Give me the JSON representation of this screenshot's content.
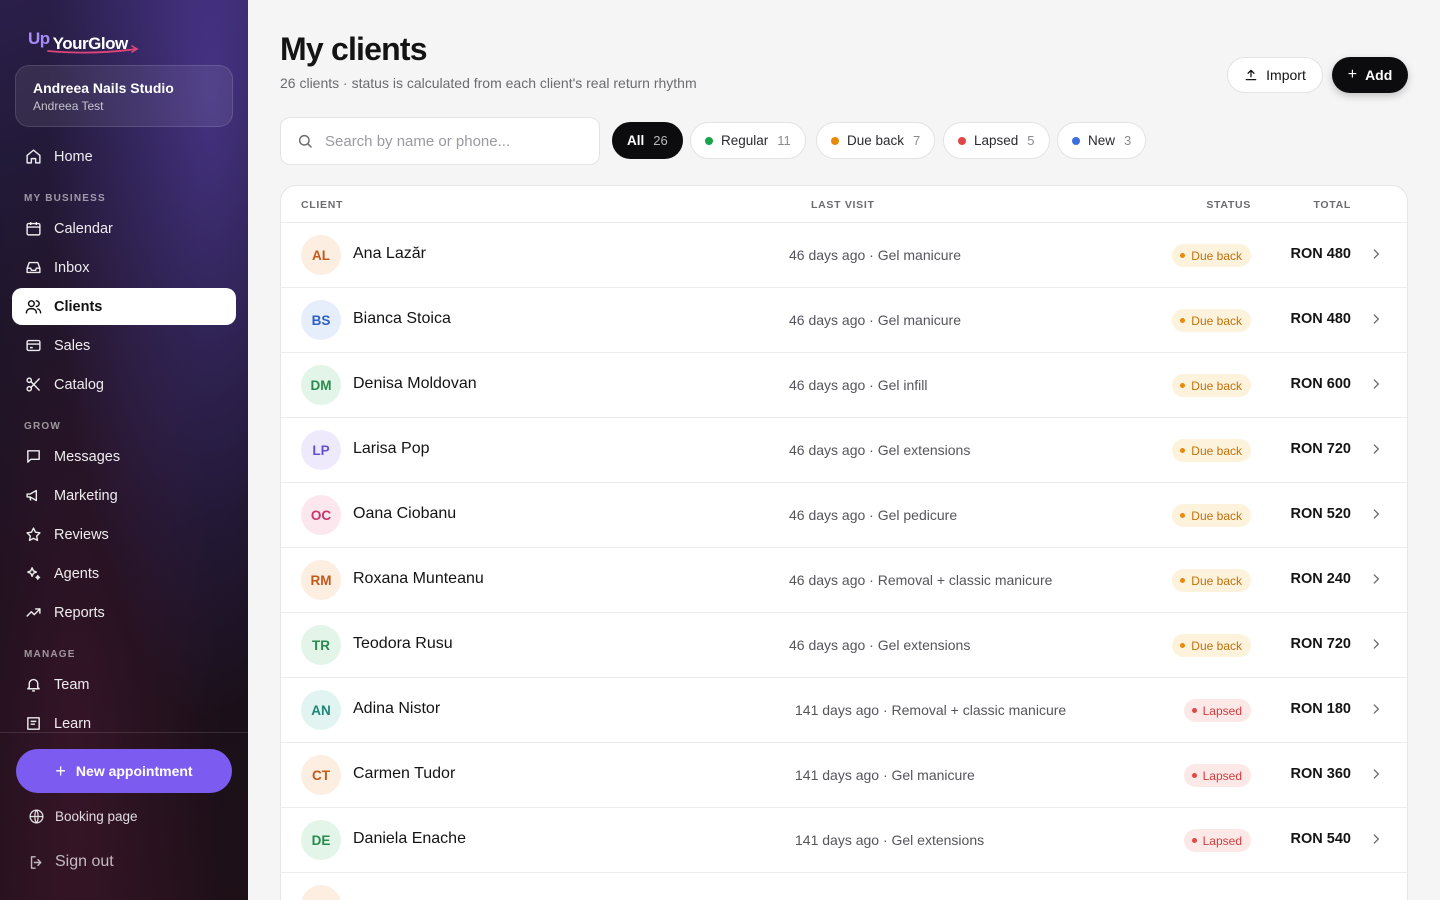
{
  "brand": {
    "up": "Up",
    "name": "YourGlow"
  },
  "studio": {
    "name": "Andreea Nails Studio",
    "owner": "Andreea Test"
  },
  "nav": {
    "home": "Home",
    "section_business": "MY BUSINESS",
    "calendar": "Calendar",
    "inbox": "Inbox",
    "clients": "Clients",
    "sales": "Sales",
    "catalog": "Catalog",
    "section_grow": "GROW",
    "messages": "Messages",
    "marketing": "Marketing",
    "reviews": "Reviews",
    "agents": "Agents",
    "reports": "Reports",
    "section_manage": "MANAGE",
    "team": "Team",
    "learn": "Learn"
  },
  "sidebar_footer": {
    "new_appointment": "New appointment",
    "booking_page": "Booking page",
    "sign_out": "Sign out"
  },
  "header": {
    "title": "My clients",
    "subtitle": "26 clients · status is calculated from each client's real return rhythm",
    "import_label": "Import",
    "add_label": "Add"
  },
  "search": {
    "placeholder": "Search by name or phone..."
  },
  "filters": [
    {
      "label": "All",
      "count": "26",
      "color": ""
    },
    {
      "label": "Regular",
      "count": "11",
      "color": "#16a34a"
    },
    {
      "label": "Due back",
      "count": "7",
      "color": "#e8890c"
    },
    {
      "label": "Lapsed",
      "count": "5",
      "color": "#e04848"
    },
    {
      "label": "New",
      "count": "3",
      "color": "#3b6fe0"
    }
  ],
  "table": {
    "headers": {
      "client": "CLIENT",
      "last_visit": "LAST VISIT",
      "status": "STATUS",
      "total": "TOTAL"
    },
    "rows": [
      {
        "initials": "AL",
        "name": "Ana Lazăr",
        "last_visit": "46 days ago · Gel manicure",
        "status": "Due back",
        "total": "RON 480"
      },
      {
        "initials": "BS",
        "name": "Bianca Stoica",
        "last_visit": "46 days ago · Gel manicure",
        "status": "Due back",
        "total": "RON 480"
      },
      {
        "initials": "DM",
        "name": "Denisa Moldovan",
        "last_visit": "46 days ago · Gel infill",
        "status": "Due back",
        "total": "RON 600"
      },
      {
        "initials": "LP",
        "name": "Larisa Pop",
        "last_visit": "46 days ago · Gel extensions",
        "status": "Due back",
        "total": "RON 720"
      },
      {
        "initials": "OC",
        "name": "Oana Ciobanu",
        "last_visit": "46 days ago · Gel pedicure",
        "status": "Due back",
        "total": "RON 520"
      },
      {
        "initials": "RM",
        "name": "Roxana Munteanu",
        "last_visit": "46 days ago · Removal + classic manicure",
        "status": "Due back",
        "total": "RON 240"
      },
      {
        "initials": "TR",
        "name": "Teodora Rusu",
        "last_visit": "46 days ago · Gel extensions",
        "status": "Due back",
        "total": "RON 720"
      },
      {
        "initials": "AN",
        "name": "Adina Nistor",
        "last_visit": "141 days ago · Removal + classic manicure",
        "status": "Lapsed",
        "total": "RON 180"
      },
      {
        "initials": "CT",
        "name": "Carmen Tudor",
        "last_visit": "141 days ago · Gel manicure",
        "status": "Lapsed",
        "total": "RON 360"
      },
      {
        "initials": "DE",
        "name": "Daniela Enache",
        "last_visit": "141 days ago · Gel extensions",
        "status": "Lapsed",
        "total": "RON 540"
      }
    ]
  },
  "colors": {
    "accent": "#7c5cf0",
    "due_back_bg": "#fdf3dc",
    "due_back_text": "#c2700a",
    "due_back_dot": "#e8890c",
    "lapsed_bg": "#fde8e8",
    "lapsed_text": "#d23c3c",
    "lapsed_dot": "#e04848",
    "avatars": [
      {
        "bg": "#fdeee2",
        "fg": "#c25a1c"
      },
      {
        "bg": "#e6eefc",
        "fg": "#2e5fc9"
      },
      {
        "bg": "#e3f5e9",
        "fg": "#2a8a4d"
      },
      {
        "bg": "#eeeafc",
        "fg": "#6a4fd1"
      },
      {
        "bg": "#fce7ef",
        "fg": "#c9366b"
      },
      {
        "bg": "#fdeee2",
        "fg": "#c25a1c"
      },
      {
        "bg": "#e3f5e9",
        "fg": "#2a8a4d"
      },
      {
        "bg": "#e2f4f1",
        "fg": "#1f8577"
      },
      {
        "bg": "#fdeee2",
        "fg": "#c25a1c"
      },
      {
        "bg": "#e3f5e9",
        "fg": "#2a8a4d"
      }
    ]
  }
}
